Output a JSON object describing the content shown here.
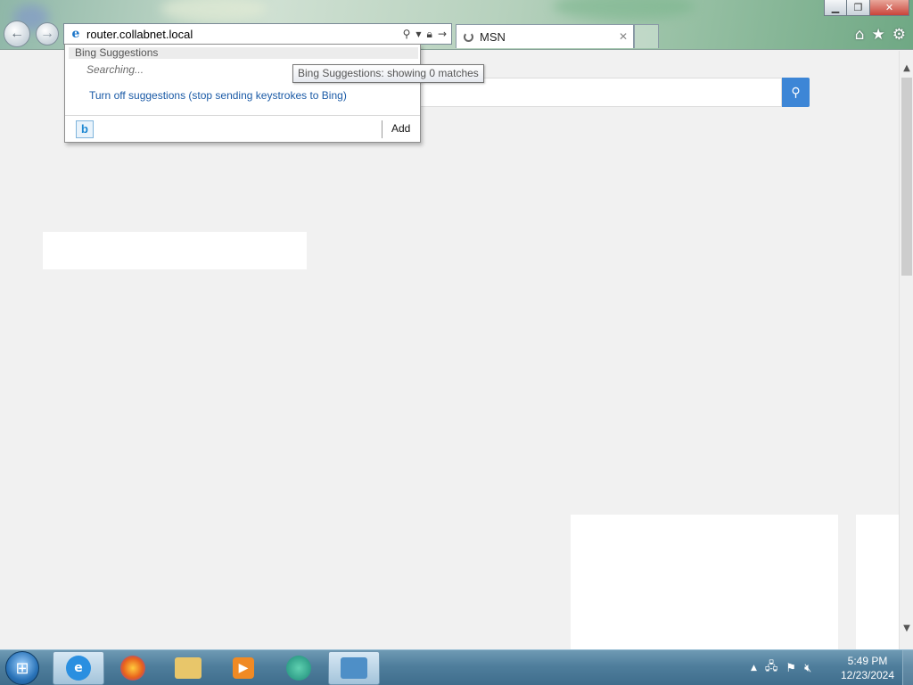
{
  "window": {
    "minimize_icon": "minimize-icon",
    "restore_icon": "restore-icon",
    "close_icon": "close-icon"
  },
  "navigation": {
    "back_icon": "back-arrow-icon",
    "forward_icon": "forward-arrow-icon"
  },
  "address_bar": {
    "value": "router.collabnet.local",
    "site_icon": "ie-logo-icon",
    "icons": [
      "search-icon",
      "dropdown-icon",
      "lock-icon",
      "go-arrow-icon"
    ]
  },
  "tabs": [
    {
      "title": "MSN",
      "status": "loading",
      "close_label": "✕"
    }
  ],
  "toolbar_icons": [
    "home-icon",
    "favorites-star-icon",
    "settings-gear-icon"
  ],
  "suggestions": {
    "header": "Bing Suggestions",
    "status": "Searching...",
    "turn_off_link": "Turn off suggestions (stop sending keystrokes to Bing)",
    "provider_icon": "bing-icon",
    "add_label": "Add",
    "tooltip": "Bing Suggestions: showing 0 matches"
  },
  "page": {
    "search_icon": "search-icon"
  },
  "taskbar": {
    "pinned": [
      "start-orb-icon",
      "internet-explorer-icon",
      "firefox-icon",
      "file-explorer-icon",
      "media-player-icon",
      "app-icon",
      "remote-desktop-icon"
    ],
    "tray_icons": [
      "show-hidden-icons-icon",
      "network-icon",
      "action-center-flag-icon",
      "volume-muted-icon"
    ],
    "time": "5:49 PM",
    "date": "12/23/2024"
  },
  "colors": {
    "accent_blue": "#3d86d6",
    "link_blue": "#1a5aa6",
    "close_red": "#c9443a"
  }
}
